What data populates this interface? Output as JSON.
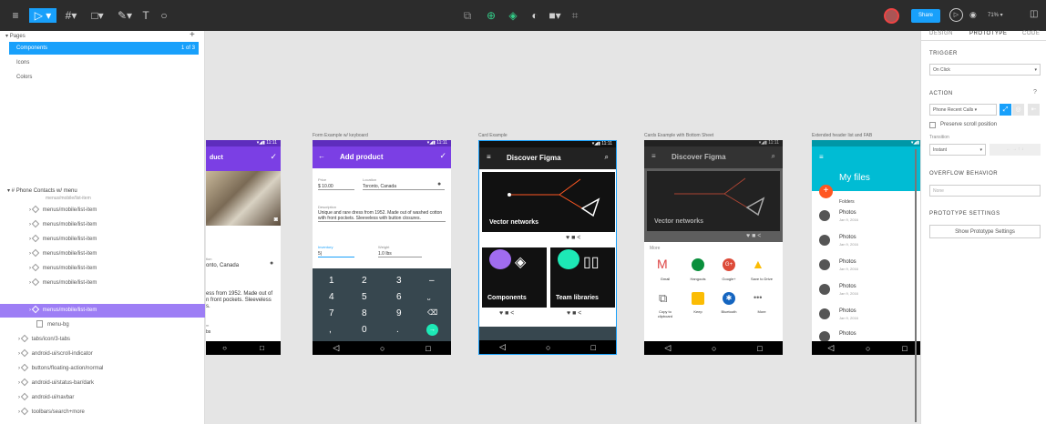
{
  "topbar": {
    "share": "Share",
    "zoom": "71%",
    "play": "▷",
    "t": "T"
  },
  "pages": {
    "header": "Pages",
    "items": [
      {
        "label": "Components",
        "count": "1 of 3"
      },
      {
        "label": "Icons"
      },
      {
        "label": "Colors"
      }
    ]
  },
  "layers": {
    "frame": "Phone Contacts w/ menu",
    "partial": "menus/mobile/list-item",
    "items": [
      "menus/mobile/list-item",
      "menus/mobile/list-item",
      "menus/mobile/list-item",
      "menus/mobile/list-item",
      "menus/mobile/list-item",
      "menus/mobile/list-item",
      "menus/mobile/list-item"
    ],
    "menubg": "menu-bg",
    "more": [
      "tabs/icon/3-tabs",
      "android-ui/scroll-indicator",
      "buttons/floating-action/normal",
      "android-ui/status-bar/dark",
      "android-ui/navbar",
      "toolbars/search+more"
    ]
  },
  "frames": {
    "f1": {
      "title": "Add product",
      "partial_title": "duct",
      "f1a": "tion",
      "f1b": "onto, Canada",
      "f1c": "ess from 1952. Made out of",
      "f1d": "n front pockets. Sleeveless",
      "f1e": "s.",
      "f1f": "bs",
      "f1g": "m"
    },
    "f2": {
      "label": "Form Example w/ keyboard",
      "title": "Add product",
      "price_l": "Price",
      "price": "$ 10.00",
      "loc_l": "Location",
      "loc": "Toronto, Canada",
      "desc_l": "Description",
      "desc": "Unique and rare dress from 1952. Made out of washed cotton with front pockets. Sleeveless with button closures.",
      "inv_l": "Inventory",
      "inv": "5|",
      "wt_l": "Weight",
      "wt": "1.0 lbs",
      "keys": [
        "1",
        "2",
        "3",
        "–",
        "4",
        "5",
        "6",
        "⎵",
        "7",
        "8",
        "9",
        "⌫",
        "",
        ",",
        "0",
        ".",
        "→"
      ]
    },
    "f3": {
      "label": "Card Example",
      "title": "Discover Figma",
      "card1": "Vector networks",
      "card2": "Components",
      "card3": "Team libraries"
    },
    "f4": {
      "label": "Cards Example with Bottom Sheet",
      "title": "Discover Figma",
      "card1": "Vector networks",
      "more": "More",
      "apps": [
        "Gmail",
        "Hangouts",
        "Google+",
        "Save to Drive",
        "Copy to clipboard",
        "Keep",
        "Bluetooth",
        "More"
      ]
    },
    "f5": {
      "label": "Extended header list and FAB",
      "title": "My files",
      "folders": "Folders",
      "items": [
        {
          "name": "Photos",
          "date": "Jan 9, 2016"
        },
        {
          "name": "Photos",
          "date": "Jan 9, 2016"
        },
        {
          "name": "Photos",
          "date": "Jan 9, 2016"
        },
        {
          "name": "Photos",
          "date": "Jan 9, 2016"
        },
        {
          "name": "Photos",
          "date": "Jan 9, 2016"
        },
        {
          "name": "Photos",
          "date": ""
        }
      ]
    }
  },
  "right": {
    "tabs": [
      "DESIGN",
      "PROTOTYPE",
      "CODE"
    ],
    "trigger": "TRIGGER",
    "trigger_val": "On Click",
    "action": "ACTION",
    "action_val": "Phone Recent Calls",
    "preserve": "Preserve scroll position",
    "transition": "Transition",
    "transition_val": "Instant",
    "overflow": "OVERFLOW BEHAVIOR",
    "overflow_val": "None",
    "proto": "PROTOTYPE SETTINGS",
    "proto_btn": "Show Prototype Settings"
  },
  "colors": {
    "accent": "#18a0fb",
    "purple": "#7b3fe4",
    "teal": "#00bcd4",
    "dark": "#2c2c2c"
  }
}
